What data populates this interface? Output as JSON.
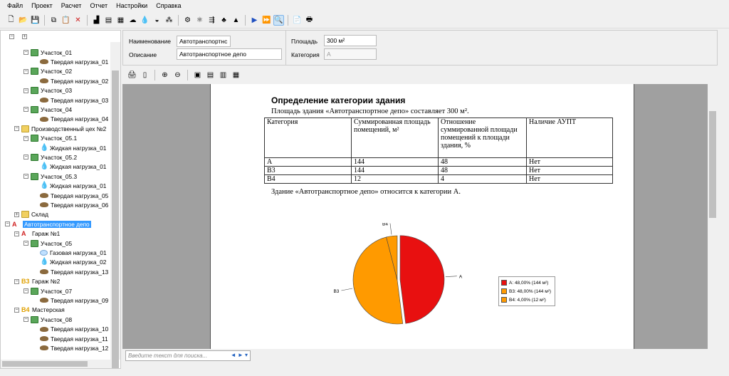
{
  "menu": [
    "Файл",
    "Проект",
    "Расчет",
    "Отчет",
    "Настройки",
    "Справка"
  ],
  "toolbar": {
    "icons": [
      "new-icon",
      "open-icon",
      "save-icon",
      "sep",
      "copy-icon",
      "paste-icon",
      "delete-icon",
      "sep",
      "add-building-icon",
      "add-floor-icon",
      "add-plot-icon",
      "add-gas-icon",
      "add-liquid-icon",
      "add-solid-icon",
      "add-dust-icon",
      "sep",
      "calc-icon",
      "calc-all-icon",
      "calc-step-icon",
      "calc-tree-icon",
      "chart-icon",
      "sep",
      "play-icon",
      "fast-forward-icon",
      "zoom-icon",
      "sep",
      "report-icon",
      "print-icon"
    ],
    "active_index": 24
  },
  "tree": {
    "rows": [
      {
        "depth": 2,
        "exp": "-",
        "icon": "plot",
        "label": "Участок_01"
      },
      {
        "depth": 3,
        "exp": "",
        "icon": "solid",
        "label": "Твердая нагрузка_01"
      },
      {
        "depth": 2,
        "exp": "-",
        "icon": "plot",
        "label": "Участок_02"
      },
      {
        "depth": 3,
        "exp": "",
        "icon": "solid",
        "label": "Твердая нагрузка_02"
      },
      {
        "depth": 2,
        "exp": "-",
        "icon": "plot",
        "label": "Участок_03"
      },
      {
        "depth": 3,
        "exp": "",
        "icon": "solid",
        "label": "Твердая нагрузка_03"
      },
      {
        "depth": 2,
        "exp": "-",
        "icon": "plot",
        "label": "Участок_04"
      },
      {
        "depth": 3,
        "exp": "",
        "icon": "solid",
        "label": "Твердая нагрузка_04"
      },
      {
        "depth": 1,
        "exp": "-",
        "icon": "folder",
        "label": "Производственный цех №2"
      },
      {
        "depth": 2,
        "exp": "-",
        "icon": "plot",
        "label": "Участок_05.1"
      },
      {
        "depth": 3,
        "exp": "",
        "icon": "liquid",
        "label": "Жидкая нагрузка_01"
      },
      {
        "depth": 2,
        "exp": "-",
        "icon": "plot",
        "label": "Участок_05.2"
      },
      {
        "depth": 3,
        "exp": "",
        "icon": "liquid",
        "label": "Жидкая нагрузка_01"
      },
      {
        "depth": 2,
        "exp": "-",
        "icon": "plot",
        "label": "Участок_05.3"
      },
      {
        "depth": 3,
        "exp": "",
        "icon": "liquid",
        "label": "Жидкая нагрузка_01"
      },
      {
        "depth": 3,
        "exp": "",
        "icon": "solid",
        "label": "Твердая нагрузка_05"
      },
      {
        "depth": 3,
        "exp": "",
        "icon": "solid",
        "label": "Твердая нагрузка_06"
      },
      {
        "depth": 1,
        "exp": "+",
        "icon": "folder",
        "label": "Склад"
      },
      {
        "depth": 0,
        "exp": "-",
        "icon": "catA",
        "cat": "A",
        "label": "Автотранспортное депо",
        "selected": true
      },
      {
        "depth": 1,
        "exp": "-",
        "icon": "catA",
        "cat": "A",
        "label": "Гараж №1"
      },
      {
        "depth": 2,
        "exp": "-",
        "icon": "plot",
        "label": "Участок_05"
      },
      {
        "depth": 3,
        "exp": "",
        "icon": "gas",
        "label": "Газовая нагрузка_01"
      },
      {
        "depth": 3,
        "exp": "",
        "icon": "liquid",
        "label": "Жидкая нагрузка_02"
      },
      {
        "depth": 3,
        "exp": "",
        "icon": "solid",
        "label": "Твердая нагрузка_13"
      },
      {
        "depth": 1,
        "exp": "-",
        "icon": "catB",
        "cat": "В3",
        "label": "Гараж №2"
      },
      {
        "depth": 2,
        "exp": "-",
        "icon": "plot",
        "label": "Участок_07"
      },
      {
        "depth": 3,
        "exp": "",
        "icon": "solid",
        "label": "Твердая нагрузка_09"
      },
      {
        "depth": 1,
        "exp": "-",
        "icon": "catB",
        "cat": "В4",
        "label": "Мастерская"
      },
      {
        "depth": 2,
        "exp": "-",
        "icon": "plot",
        "label": "Участок_08"
      },
      {
        "depth": 3,
        "exp": "",
        "icon": "solid",
        "label": "Твердая нагрузка_10"
      },
      {
        "depth": 3,
        "exp": "",
        "icon": "solid",
        "label": "Твердая нагрузка_11"
      },
      {
        "depth": 3,
        "exp": "",
        "icon": "solid",
        "label": "Твердая нагрузка_12"
      }
    ]
  },
  "props": {
    "name_label": "Наименование",
    "name_value": "Автотранспортнс",
    "desc_label": "Описание",
    "desc_value": "Автотранспортное депо",
    "area_label": "Площадь",
    "area_value": "300 м²",
    "cat_label": "Категория",
    "cat_value": "А"
  },
  "search": {
    "placeholder": "Введите текст для поиска...",
    "nav": "◄ ► ▾"
  },
  "report": {
    "title": "Определение категории здания",
    "intro": "Площадь здания «Автотранспортное депо» составляет 300 м².",
    "conclusion": "Здание «Автотранспортное депо» относится к категории А.",
    "headers": [
      "Категория",
      "Суммированная площадь помещений, м²",
      "Отношение суммированной площади помещений к площади здания, %",
      "Наличие АУПТ"
    ],
    "rows": [
      [
        "А",
        "144",
        "48",
        "Нет"
      ],
      [
        "В3",
        "144",
        "48",
        "Нет"
      ],
      [
        "В4",
        "12",
        "4",
        "Нет"
      ]
    ]
  },
  "chart_data": {
    "type": "pie",
    "slices": [
      {
        "label": "А",
        "value": 48,
        "legend": "А: 48,00% (144 м²)",
        "color": "#e81010"
      },
      {
        "label": "В3",
        "value": 48,
        "legend": "В3: 48,00% (144 м²)",
        "color": "#ff9a00"
      },
      {
        "label": "В4",
        "value": 4,
        "legend": "В4: 4,00% (12 м²)",
        "color": "#ff9a00"
      }
    ],
    "legend_position": "right"
  }
}
